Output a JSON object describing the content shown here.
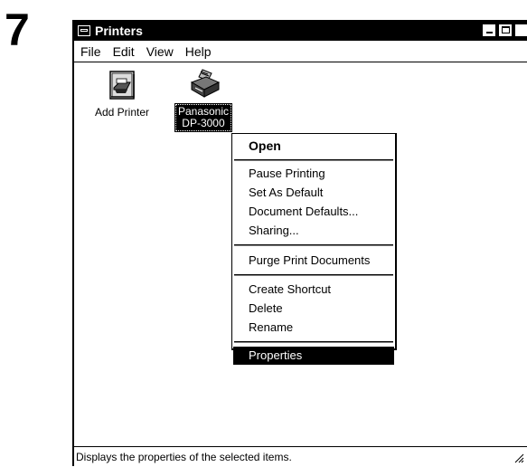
{
  "step_number": "7",
  "window": {
    "title": "Printers",
    "icon": "printer-folder-icon",
    "buttons": [
      "minimize",
      "maximize",
      "close"
    ]
  },
  "menubar": {
    "items": [
      "File",
      "Edit",
      "View",
      "Help"
    ]
  },
  "icons": [
    {
      "label": "Add Printer",
      "icon": "add-printer-icon",
      "selected": false
    },
    {
      "label_line1": "Panasonic",
      "label_line2": "DP-3000",
      "icon": "printer-icon",
      "selected": true
    }
  ],
  "context_menu": {
    "items": [
      "Open",
      "Pause Printing",
      "Set As Default",
      "Document Defaults...",
      "Sharing...",
      "Purge Print Documents",
      "Create Shortcut",
      "Delete",
      "Rename",
      "Properties"
    ],
    "highlighted": "Properties"
  },
  "statusbar": {
    "text": "Displays the properties of the selected items."
  },
  "colors": {
    "titlebar": "#000000",
    "highlight": "#000000",
    "background": "#ffffff"
  }
}
